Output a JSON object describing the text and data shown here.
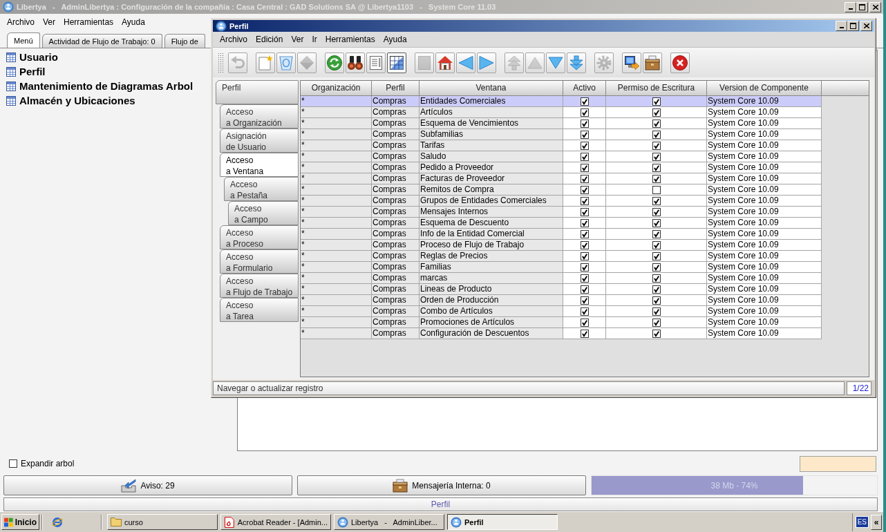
{
  "main_window": {
    "title": "Libertya   -   AdminLibertya : Configuración de la compañía : Casa Central : GAD Solutions SA @ Libertya1103   -   System Core 11.03",
    "active": false,
    "menu": [
      "Archivo",
      "Ver",
      "Herramientas",
      "Ayuda"
    ],
    "tabs": [
      {
        "label": "Menú",
        "selected": true
      },
      {
        "label": "Actividad de Flujo de Trabajo: 0",
        "selected": false
      },
      {
        "label": "Flujo de",
        "selected": false
      }
    ],
    "tree": [
      "Usuario",
      "Perfil",
      "Mantenimiento de Diagramas Arbol",
      "Almacén y Ubicaciones"
    ],
    "expand_tree": {
      "label": "Expandir arbol",
      "checked": false
    },
    "buttons": [
      {
        "label": "Aviso: 29"
      },
      {
        "label": "Mensajería Interna: 0"
      }
    ],
    "memory": {
      "reading": "38 Mb - 74%",
      "level": 0.74
    },
    "status": "Perfil"
  },
  "perfil_window": {
    "title": "Perfil",
    "active": true,
    "menu": [
      "Archivo",
      "Edición",
      "Ver",
      "Ir",
      "Herramientas",
      "Ayuda"
    ],
    "toolbar": [
      [
        {
          "disabled": true,
          "on": false
        }
      ],
      [
        {
          "disabled": false,
          "on": false
        },
        {
          "disabled": false,
          "on": false
        },
        {
          "disabled": true,
          "on": false
        }
      ],
      [
        {
          "disabled": false,
          "on": false
        },
        {
          "disabled": false,
          "on": false
        },
        {
          "disabled": false,
          "on": false
        },
        {
          "disabled": false,
          "on": true
        }
      ],
      [
        {
          "disabled": true,
          "on": false
        },
        {
          "disabled": false,
          "on": false
        },
        {
          "disabled": false,
          "on": false
        },
        {
          "disabled": false,
          "on": false
        }
      ],
      [
        {
          "disabled": true,
          "on": false
        },
        {
          "disabled": true,
          "on": false
        },
        {
          "disabled": false,
          "on": false
        },
        {
          "disabled": false,
          "on": false
        }
      ],
      [
        {
          "disabled": true,
          "on": false
        }
      ],
      [
        {
          "disabled": false,
          "on": false
        },
        {
          "disabled": false,
          "on": false
        }
      ],
      [
        {
          "disabled": false,
          "on": false
        }
      ]
    ],
    "tabs": [
      {
        "label": "Perfil",
        "selected": false,
        "children": [
          {
            "label": "Acceso\na Organización",
            "selected": false
          },
          {
            "label": "Asignación\nde Usuario",
            "selected": false
          },
          {
            "label": "Acceso\na Ventana",
            "selected": true,
            "children": [
              {
                "label": "Acceso\na Pestaña",
                "selected": false,
                "children": [
                  {
                    "label": "Acceso\na Campo",
                    "selected": false
                  }
                ]
              }
            ]
          },
          {
            "label": "Acceso\na Proceso",
            "selected": false
          },
          {
            "label": "Acceso\na Formulario",
            "selected": false
          },
          {
            "label": "Acceso\na Flujo de Trabajo",
            "selected": false
          },
          {
            "label": "Acceso\na Tarea",
            "selected": false
          }
        ]
      }
    ],
    "table": {
      "columns": [
        {
          "label": "Organización",
          "kind": "text",
          "read_only": true
        },
        {
          "label": "Perfil",
          "kind": "text",
          "read_only": true
        },
        {
          "label": "Ventana",
          "kind": "text",
          "read_only": true
        },
        {
          "label": "Activo",
          "kind": "check",
          "read_only": false
        },
        {
          "label": "Permiso de Escritura",
          "kind": "check",
          "read_only": false
        },
        {
          "label": "Version de Componente",
          "kind": "text",
          "read_only": false
        }
      ],
      "rows": [
        {
          "selected": true,
          "cells": [
            "*",
            "Compras",
            "Entidades Comerciales",
            true,
            true,
            "System Core 10.09"
          ]
        },
        {
          "selected": false,
          "cells": [
            "*",
            "Compras",
            "Artículos",
            true,
            true,
            "System Core 10.09"
          ]
        },
        {
          "selected": false,
          "cells": [
            "*",
            "Compras",
            "Esquema de Vencimientos",
            true,
            true,
            "System Core 10.09"
          ]
        },
        {
          "selected": false,
          "cells": [
            "*",
            "Compras",
            "Subfamilias",
            true,
            true,
            "System Core 10.09"
          ]
        },
        {
          "selected": false,
          "cells": [
            "*",
            "Compras",
            "Tarifas",
            true,
            true,
            "System Core 10.09"
          ]
        },
        {
          "selected": false,
          "cells": [
            "*",
            "Compras",
            "Saludo",
            true,
            true,
            "System Core 10.09"
          ]
        },
        {
          "selected": false,
          "cells": [
            "*",
            "Compras",
            "Pedido a Proveedor",
            true,
            true,
            "System Core 10.09"
          ]
        },
        {
          "selected": false,
          "cells": [
            "*",
            "Compras",
            "Facturas de Proveedor",
            true,
            true,
            "System Core 10.09"
          ]
        },
        {
          "selected": false,
          "cells": [
            "*",
            "Compras",
            "Remitos de Compra",
            true,
            false,
            "System Core 10.09"
          ]
        },
        {
          "selected": false,
          "cells": [
            "*",
            "Compras",
            "Grupos de Entidades Comerciales",
            true,
            true,
            "System Core 10.09"
          ]
        },
        {
          "selected": false,
          "cells": [
            "*",
            "Compras",
            "Mensajes Internos",
            true,
            true,
            "System Core 10.09"
          ]
        },
        {
          "selected": false,
          "cells": [
            "*",
            "Compras",
            "Esquema de Descuento",
            true,
            true,
            "System Core 10.09"
          ]
        },
        {
          "selected": false,
          "cells": [
            "*",
            "Compras",
            "Info de la Entidad Comercial",
            true,
            true,
            "System Core 10.09"
          ]
        },
        {
          "selected": false,
          "cells": [
            "*",
            "Compras",
            "Proceso de Flujo de Trabajo",
            true,
            true,
            "System Core 10.09"
          ]
        },
        {
          "selected": false,
          "cells": [
            "*",
            "Compras",
            "Reglas de Precios",
            true,
            true,
            "System Core 10.09"
          ]
        },
        {
          "selected": false,
          "cells": [
            "*",
            "Compras",
            "Familias",
            true,
            true,
            "System Core 10.09"
          ]
        },
        {
          "selected": false,
          "cells": [
            "*",
            "Compras",
            "marcas",
            true,
            true,
            "System Core 10.09"
          ]
        },
        {
          "selected": false,
          "cells": [
            "*",
            "Compras",
            "Lineas de Producto",
            true,
            true,
            "System Core 10.09"
          ]
        },
        {
          "selected": false,
          "cells": [
            "*",
            "Compras",
            "Orden de Producción",
            true,
            true,
            "System Core 10.09"
          ]
        },
        {
          "selected": false,
          "cells": [
            "*",
            "Compras",
            "Combo de Artículos",
            true,
            true,
            "System Core 10.09"
          ]
        },
        {
          "selected": false,
          "cells": [
            "*",
            "Compras",
            "Promociones de Artículos",
            true,
            true,
            "System Core 10.09"
          ]
        },
        {
          "selected": false,
          "cells": [
            "*",
            "Compras",
            "Configuración de Descuentos",
            true,
            true,
            "System Core 10.09"
          ]
        }
      ]
    },
    "status": {
      "message": "Navegar o actualizar registro",
      "record": "1/22"
    }
  },
  "taskbar": {
    "start": "Inicio",
    "tasks": [
      {
        "label": "curso",
        "selected": false
      },
      {
        "label": "Acrobat Reader - [Admin...",
        "selected": false
      },
      {
        "label": "Libertya   -   AdminLiber...",
        "selected": false
      },
      {
        "label": "Perfil",
        "selected": true
      }
    ],
    "language": "ES",
    "tray_toggle": "«"
  }
}
